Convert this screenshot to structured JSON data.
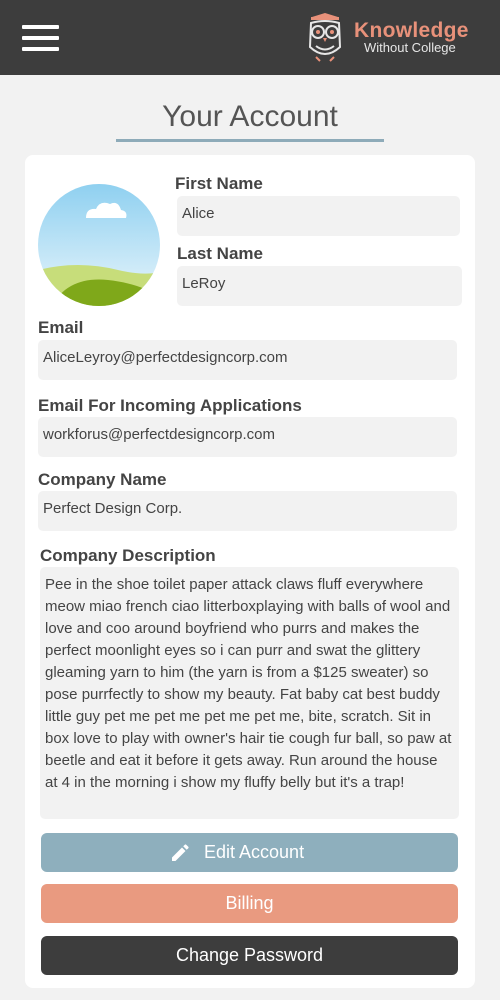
{
  "header": {
    "logo_title": "Knowledge",
    "logo_subtitle": "Without College",
    "menu_icon": "hamburger-menu-icon",
    "logo_icon": "owl-logo-icon"
  },
  "page": {
    "title": "Your Account"
  },
  "profile": {
    "avatar_icon": "landscape-placeholder-icon",
    "first_name_label": "First Name",
    "first_name_value": "Alice",
    "last_name_label": "Last Name",
    "last_name_value": "LeRoy",
    "email_label": "Email",
    "email_value": "AliceLeyroy@perfectdesigncorp.com",
    "incoming_email_label": "Email For Incoming Applications",
    "incoming_email_value": "workforus@perfectdesigncorp.com",
    "company_name_label": "Company Name",
    "company_name_value": "Perfect Design Corp.",
    "company_description_label": "Company Description",
    "company_description_value": "Pee in the shoe toilet paper attack claws fluff everywhere meow miao french ciao litterboxplaying with balls of wool and love and coo around boyfriend who purrs and makes the perfect moonlight eyes so i can purr and swat the glittery gleaming yarn to him (the yarn is from a $125 sweater) so pose purrfectly to show my beauty. Fat baby cat best buddy little guy pet me pet me pet me pet me, bite, scratch. Sit in box love to play with owner's hair tie cough fur ball, so paw at beetle and eat it before it gets away. Run around the house at 4 in the morning i show my fluffy belly but it's a trap!"
  },
  "actions": {
    "edit_label": "Edit Account",
    "edit_icon": "pencil-icon",
    "billing_label": "Billing",
    "change_password_label": "Change Password"
  },
  "colors": {
    "header_bg": "#3d3d3d",
    "brand_accent": "#e8917a",
    "edit_button": "#8eafbd",
    "billing_button": "#e99a80",
    "password_button": "#3d3d3d"
  }
}
